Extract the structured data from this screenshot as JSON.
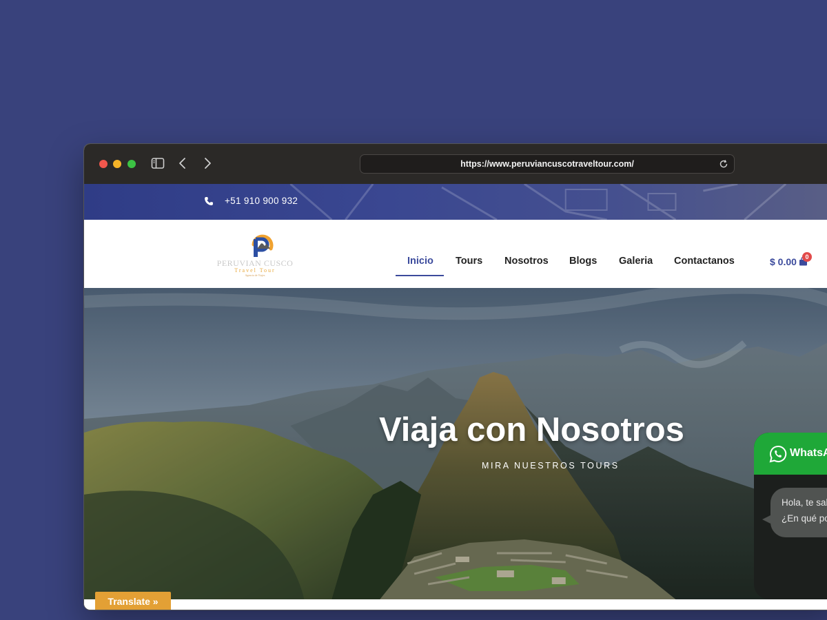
{
  "browser": {
    "url": "https://www.peruviancuscotraveltour.com/"
  },
  "topbar": {
    "phone": "+51 910 900 932"
  },
  "logo": {
    "name": "PERUVIAN CUSCO",
    "tagline": "Travel Tour",
    "subtagline": "Agencia de Viajes"
  },
  "nav": {
    "items": [
      {
        "label": "Inicio",
        "active": true
      },
      {
        "label": "Tours",
        "active": false
      },
      {
        "label": "Nosotros",
        "active": false
      },
      {
        "label": "Blogs",
        "active": false
      },
      {
        "label": "Galeria",
        "active": false
      },
      {
        "label": "Contactanos",
        "active": false
      }
    ]
  },
  "cart": {
    "amount": "$ 0.00",
    "count": "0"
  },
  "hero": {
    "title": "Viaja con Nosotros",
    "subtitle": "MIRA NUESTROS TOURS"
  },
  "translate": {
    "label": "Translate »"
  },
  "whatsapp": {
    "title": "WhatsApp",
    "message_line1": "Hola, te saludamos",
    "message_line2": "¿En qué podemos ayudarte?"
  },
  "colors": {
    "page_bg": "#39427c",
    "brand_blue": "#3b4a9c",
    "whatsapp_green": "#1fa838",
    "translate_orange": "#e3a035"
  }
}
